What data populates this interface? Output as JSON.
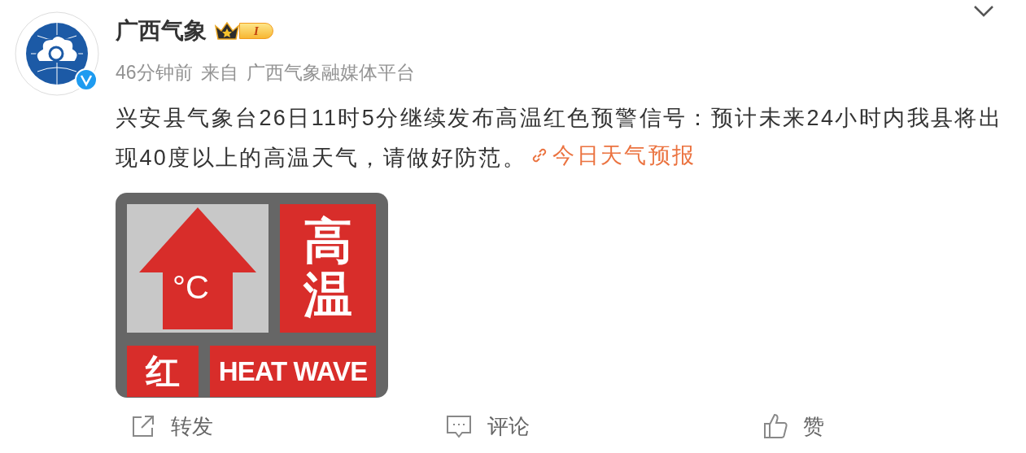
{
  "author": {
    "name": "广西气象",
    "verified": true,
    "badge": "I"
  },
  "meta": {
    "time": "46分钟前",
    "source_prefix": "来自",
    "source": "广西气象融媒体平台"
  },
  "post": {
    "text": "兴安县气象台26日11时5分继续发布高温红色预警信号：预计未来24小时内我县将出现40度以上的高温天气，请做好防范。",
    "link": "今日天气预报"
  },
  "image": {
    "symbol": "°C",
    "title": "高温",
    "grade": "红",
    "english": "HEAT WAVE"
  },
  "actions": [
    {
      "kind": "forward",
      "label": "转发"
    },
    {
      "kind": "comment",
      "label": "评论"
    },
    {
      "kind": "like",
      "label": "赞"
    }
  ]
}
